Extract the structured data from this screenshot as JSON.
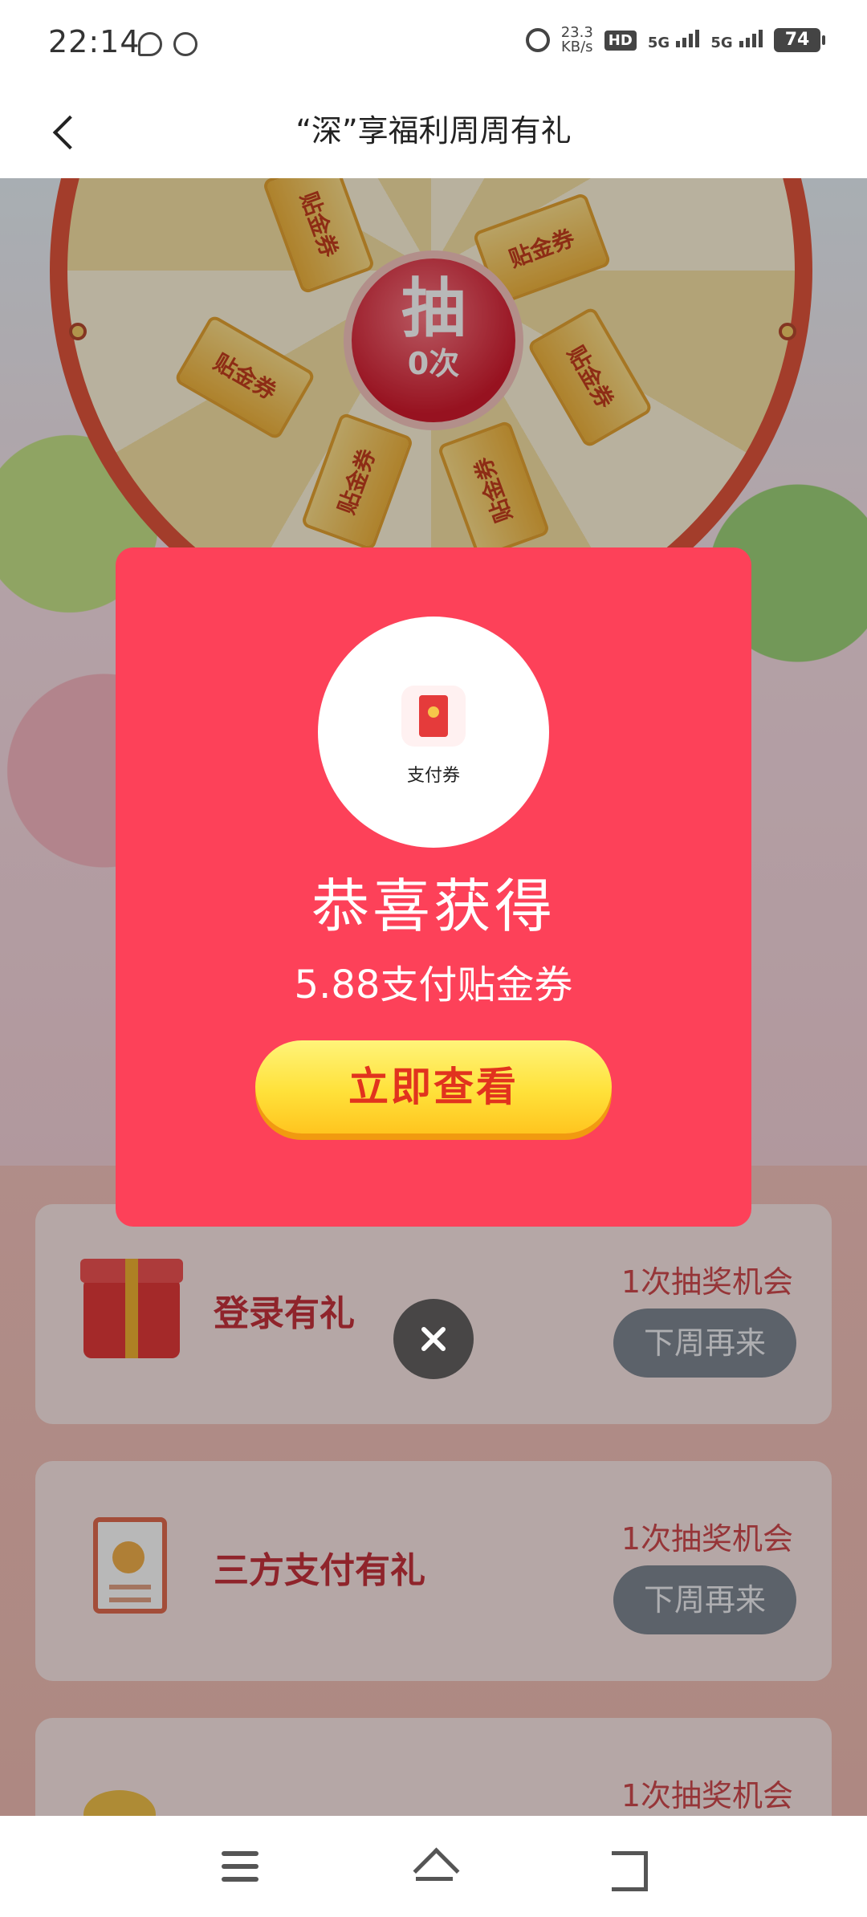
{
  "status_bar": {
    "time": "22:14",
    "net_speed_value": "23.3",
    "net_speed_unit": "KB/s",
    "hd_label": "HD",
    "sim1_label": "5G",
    "sim2_label": "5G",
    "battery": "74"
  },
  "header": {
    "title": "“深”享福利周周有礼"
  },
  "wheel": {
    "draw_char": "抽",
    "draw_count": "0次",
    "ticket_labels": [
      "贴金券",
      "贴金券",
      "贴金券",
      "贴金券",
      "贴金券",
      "贴金券"
    ]
  },
  "tasks": [
    {
      "title": "登录有礼",
      "chance": "1次抽奖机会",
      "button": "下周再来"
    },
    {
      "title": "三方支付有礼",
      "chance": "1次抽奖机会",
      "button": "下周再来"
    },
    {
      "title": "",
      "chance": "1次抽奖机会",
      "button": ""
    }
  ],
  "modal": {
    "prize_label": "支付券",
    "congrats": "恭喜获得",
    "prize_name": "5.88支付贴金券",
    "view_button": "立即查看"
  },
  "colors": {
    "modal_bg": "#fd4159",
    "button_yellow": "#ffe13a",
    "button_text_red": "#e1331e",
    "task_title_red": "#c6323c",
    "disabled_button_gray": "#808894"
  }
}
